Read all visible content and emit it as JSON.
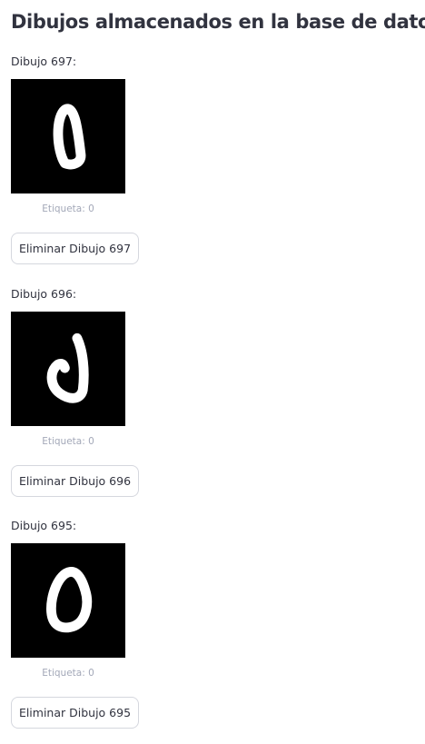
{
  "title": "Dibujos almacenados en la base de datos",
  "drawings": [
    {
      "label": "Dibujo 697:",
      "caption": "Etiqueta: 0",
      "button_label": "Eliminar Dibujo 697"
    },
    {
      "label": "Dibujo 696:",
      "caption": "Etiqueta: 0",
      "button_label": "Eliminar Dibujo 696"
    },
    {
      "label": "Dibujo 695:",
      "caption": "Etiqueta: 0",
      "button_label": "Eliminar Dibujo 695"
    }
  ]
}
